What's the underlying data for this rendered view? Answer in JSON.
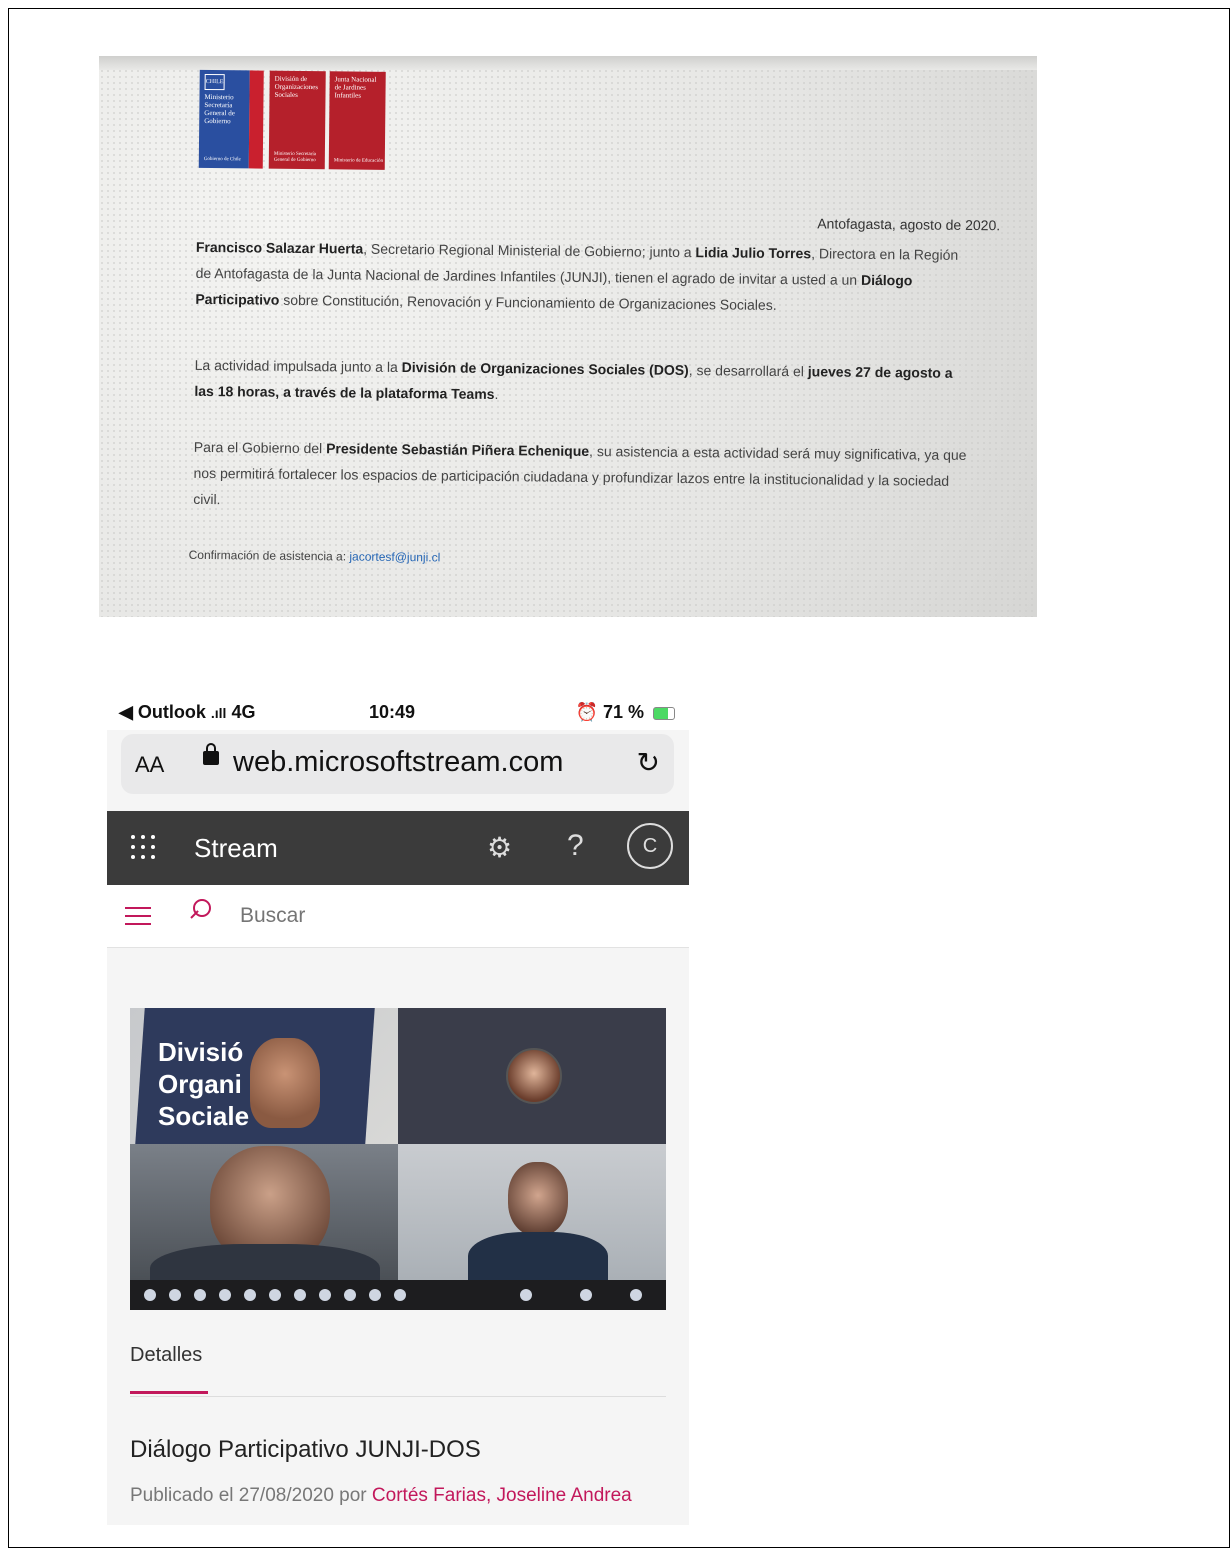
{
  "invitation": {
    "logos": [
      {
        "title": "Ministerio Secretaría General de Gobierno",
        "footer": "Gobierno de Chile",
        "shield": "CHILE"
      },
      {
        "title": "División de Organizaciones Sociales",
        "footer": "Ministerio Secretaría General de Gobierno"
      },
      {
        "title": "Junta Nacional de Jardines Infantiles",
        "footer": "Ministerio de Educación"
      }
    ],
    "date": "Antofagasta, agosto de 2020.",
    "p1": {
      "name1": "Francisco Salazar Huerta",
      "t1": ", Secretario Regional Ministerial de Gobierno; junto a ",
      "name2": "Lidia Julio Torres",
      "t2": ", Directora en la Región de Antofagasta de la Junta Nacional de Jardines Infantiles (JUNJI), tienen el agrado de invitar a usted a un ",
      "b3": "Diálogo Participativo",
      "t3": " sobre Constitución, Renovación y Funcionamiento de Organizaciones Sociales."
    },
    "p2": {
      "t1": "La actividad impulsada junto a la ",
      "b1": "División de Organizaciones Sociales (DOS)",
      "t2": ", se desarrollará el ",
      "b2": "jueves 27 de agosto a las 18 horas, a través de la plataforma Teams",
      "t3": "."
    },
    "p3": {
      "t1": "Para el Gobierno del ",
      "b1": "Presidente Sebastián Piñera Echenique",
      "t2": ", su asistencia a esta actividad será muy significativa, ya que nos permitirá fortalecer los espacios de participación ciudadana y profundizar lazos entre la institucionalidad y la sociedad civil."
    },
    "confirm_label": "Confirmación de asistencia a: ",
    "confirm_email": "jacortesf@junji.cl"
  },
  "phone": {
    "status": {
      "back_app": "◀ Outlook",
      "network": "4G",
      "time": "10:49",
      "battery": "71 %"
    },
    "browser": {
      "text_size": "AA",
      "url": "web.microsoftstream.com",
      "reload_icon": "↻"
    },
    "appbar": {
      "app_name": "Stream",
      "gear_icon": "⚙",
      "help_icon": "?",
      "avatar_initial": "C"
    },
    "search": {
      "placeholder": "Buscar"
    },
    "video": {
      "banner_text": "Divisió\nOrgani   es\nSociale",
      "participants_count": 15
    },
    "tabs": {
      "details": "Detalles"
    },
    "video_title": "Diálogo Participativo JUNJI-DOS",
    "published_prefix": "Publicado el 27/08/2020 por ",
    "author": "Cortés Farias, Joseline Andrea"
  }
}
